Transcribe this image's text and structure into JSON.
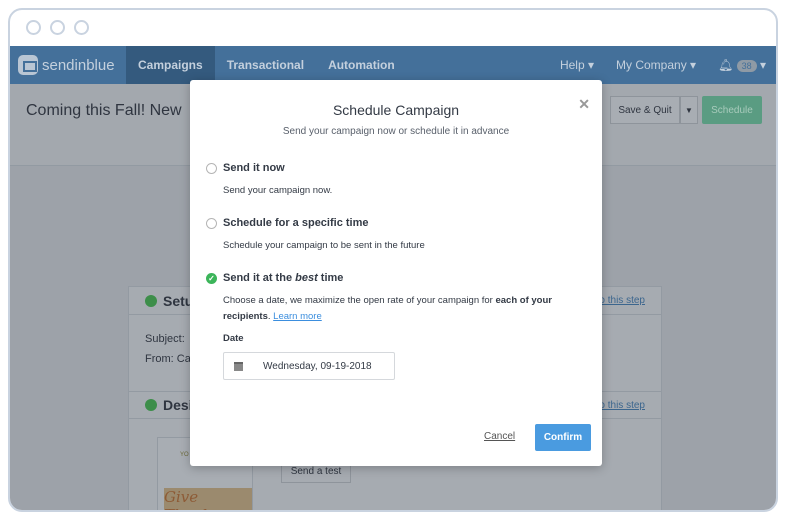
{
  "nav": {
    "brand": "sendinblue",
    "items": [
      "Campaigns",
      "Transactional",
      "Automation"
    ],
    "help": "Help ▾",
    "company": "My Company ▾",
    "notifications": "38"
  },
  "header": {
    "title": "Coming this Fall! New",
    "save_quit": "Save & Quit",
    "schedule": "Schedule"
  },
  "card": {
    "setup": "Setu",
    "subject": "Subject:",
    "from": "From:  Ca",
    "design": "Desi",
    "edit": "o this step",
    "thumb_text": "YO",
    "thanks": "Give Thanks",
    "send_test": "Send a test"
  },
  "modal": {
    "title": "Schedule Campaign",
    "subtitle": "Send your campaign now or schedule it in advance",
    "options": [
      {
        "label": "Send it now",
        "desc": "Send your campaign now.",
        "selected": false
      },
      {
        "label": "Schedule for a specific time",
        "desc": "Schedule your campaign to be sent in the future",
        "selected": false
      },
      {
        "label_pre": "Send it at the ",
        "label_em": "best",
        "label_post": " time",
        "desc_pre": "Choose a date, we maximize the open rate of your campaign for ",
        "desc_bold1": "each of your",
        "desc_bold2": "recipients",
        "desc_mid": ". ",
        "learn_more": "Learn more",
        "selected": true
      }
    ],
    "date_label": "Date",
    "date_value": "Wednesday, 09-19-2018",
    "cancel": "Cancel",
    "confirm": "Confirm"
  },
  "colors": {
    "accent": "#4a9be0",
    "success": "#3cb55a",
    "nav": "#44709a"
  }
}
